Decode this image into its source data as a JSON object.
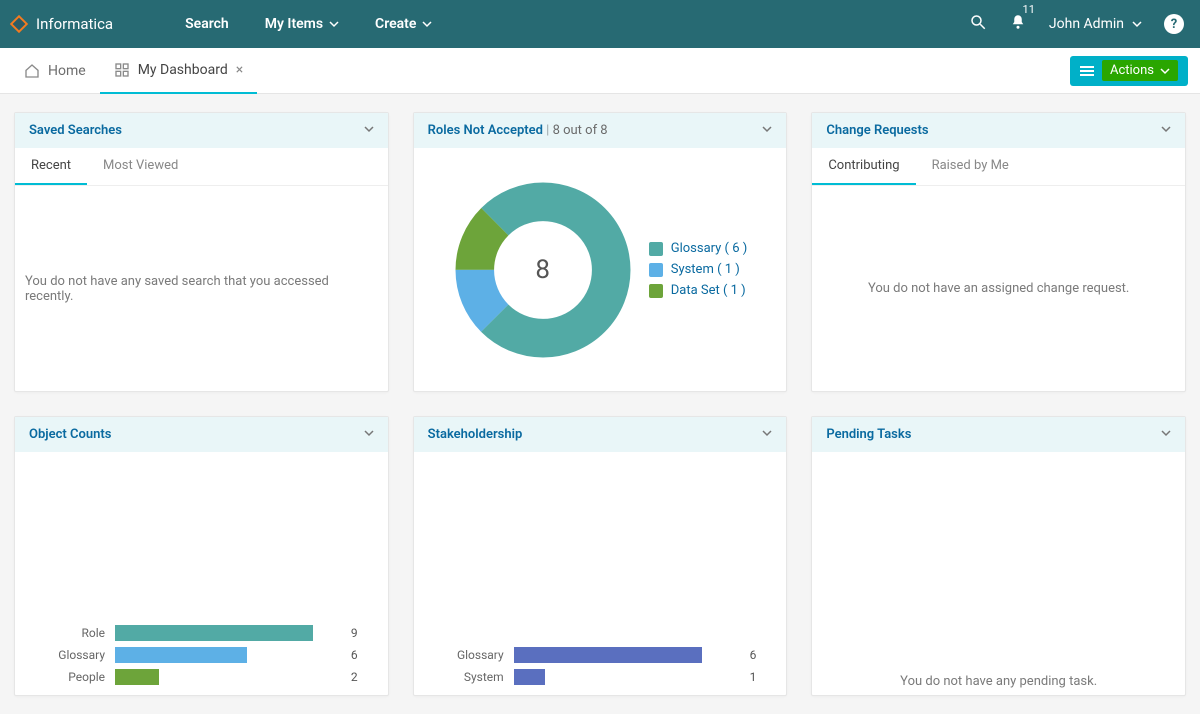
{
  "brand": "Informatica",
  "nav": {
    "search": "Search",
    "my_items": "My Items",
    "create": "Create"
  },
  "notifications": "11",
  "user_name": "John Admin",
  "tabs": {
    "home": "Home",
    "dashboard": "My Dashboard"
  },
  "actions_label": "Actions",
  "cards": {
    "saved_searches": {
      "title": "Saved Searches",
      "tab_recent": "Recent",
      "tab_most_viewed": "Most Viewed",
      "empty": "You do not have any saved search that you accessed recently."
    },
    "roles": {
      "title": "Roles Not Accepted",
      "sub": "8 out of 8",
      "center": "8",
      "legend": {
        "glossary": "Glossary ( 6 )",
        "system": "System ( 1 )",
        "dataset": "Data Set ( 1 )"
      }
    },
    "change_requests": {
      "title": "Change Requests",
      "tab_contributing": "Contributing",
      "tab_raised": "Raised by Me",
      "empty": "You do not have an assigned change request."
    },
    "object_counts": {
      "title": "Object Counts"
    },
    "stakeholdership": {
      "title": "Stakeholdership"
    },
    "pending_tasks": {
      "title": "Pending Tasks",
      "empty": "You do not have any pending task."
    }
  },
  "chart_data": [
    {
      "type": "pie",
      "title": "Roles Not Accepted",
      "total": 8,
      "series": [
        {
          "name": "Glossary",
          "value": 6,
          "color": "#52aaa5"
        },
        {
          "name": "System",
          "value": 1,
          "color": "#5db0e6"
        },
        {
          "name": "Data Set",
          "value": 1,
          "color": "#6da43a"
        }
      ]
    },
    {
      "type": "bar",
      "title": "Object Counts",
      "orientation": "horizontal",
      "xlim": [
        0,
        10
      ],
      "categories": [
        "Role",
        "Glossary",
        "People"
      ],
      "values": [
        9,
        6,
        2
      ],
      "colors": [
        "#52aaa5",
        "#5db0e6",
        "#6da43a"
      ]
    },
    {
      "type": "bar",
      "title": "Stakeholdership",
      "orientation": "horizontal",
      "xlim": [
        0,
        7
      ],
      "categories": [
        "Glossary",
        "System"
      ],
      "values": [
        6,
        1
      ],
      "colors": [
        "#5a6fbf",
        "#5a6fbf"
      ]
    }
  ]
}
